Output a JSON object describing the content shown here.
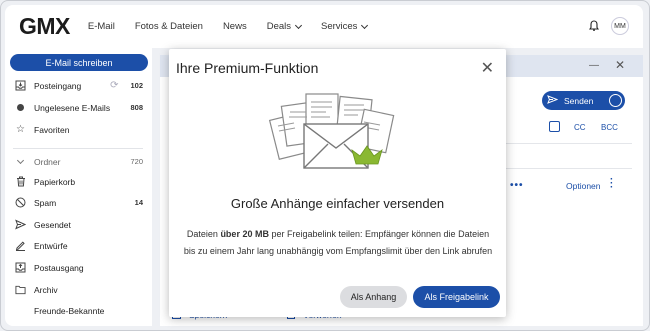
{
  "header": {
    "logo": "GMX",
    "nav": [
      {
        "label": "E-Mail"
      },
      {
        "label": "Fotos & Dateien"
      },
      {
        "label": "News"
      },
      {
        "label": "Deals"
      },
      {
        "label": "Services"
      }
    ],
    "avatar_initials": "MM"
  },
  "sidebar": {
    "compose_label": "E-Mail schreiben",
    "items": [
      {
        "label": "Posteingang",
        "count": "102",
        "icon": "inbox-icon"
      },
      {
        "label": "Ungelesene E-Mails",
        "count": "808",
        "icon": "unread-dot-icon"
      },
      {
        "label": "Favoriten",
        "icon": "star-icon"
      },
      {
        "label": "Ordner",
        "count": "720",
        "icon": "chevron-down-icon"
      },
      {
        "label": "Papierkorb",
        "icon": "trash-icon"
      },
      {
        "label": "Spam",
        "count": "14",
        "icon": "spam-icon"
      },
      {
        "label": "Gesendet",
        "icon": "sent-icon"
      },
      {
        "label": "Entwürfe",
        "icon": "pencil-icon"
      },
      {
        "label": "Postausgang",
        "icon": "outbox-icon"
      },
      {
        "label": "Archiv",
        "icon": "folder-icon"
      },
      {
        "label": "Freunde-Bekannte"
      }
    ]
  },
  "compose": {
    "send_label": "Senden",
    "cc_label": "CC",
    "bcc_label": "BCC",
    "options_label": "Optionen",
    "bottom_left": "Speichern",
    "bottom_right": "Verwerfen"
  },
  "dialog": {
    "title": "Ihre Premium-Funktion",
    "headline": "Große Anhänge einfacher versenden",
    "desc_prefix": "Dateien ",
    "desc_bold": "über 20 MB",
    "desc_suffix": " per Freigabelink teilen: Empfänger können die Dateien bis zu einem Jahr lang unabhängig vom Empfangslimit über den Link abrufen",
    "btn_secondary": "Als Anhang",
    "btn_primary": "Als Freigabelink"
  },
  "colors": {
    "accent": "#1c4fa8",
    "crown": "#8ab832"
  }
}
